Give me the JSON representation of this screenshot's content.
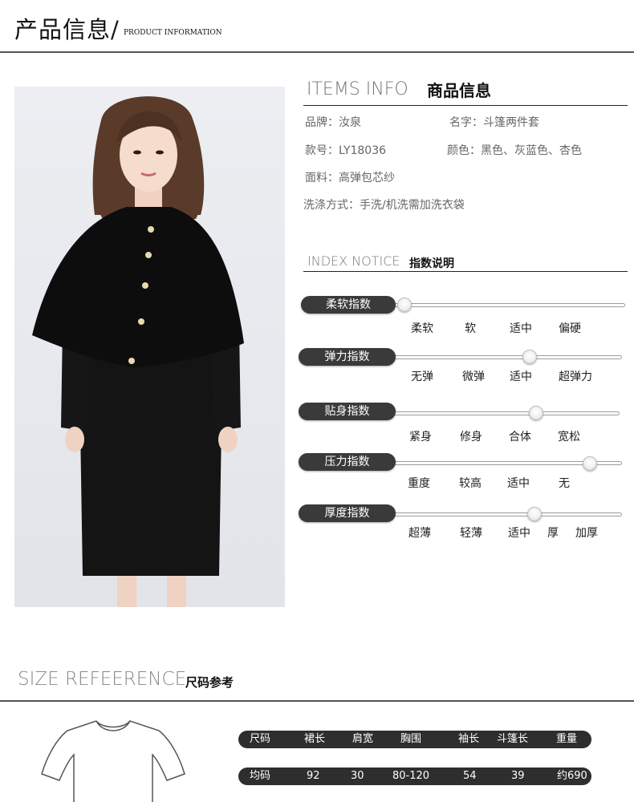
{
  "header": {
    "title_cn": "产品信息/",
    "title_en": "PRODUCT INFORMATION"
  },
  "items_info": {
    "title_en": "ITEMS INFO",
    "title_cn": "商品信息",
    "brand": "品牌：汝泉",
    "name": "名字：斗篷两件套",
    "model": "款号：LY18036",
    "colors": "颜色：黑色、灰蓝色、杏色",
    "fabric": "面料：高弹包芯纱",
    "washing": "洗涤方式：手洗/机洗需加洗衣袋"
  },
  "index_notice": {
    "title_en": "INDEX NOTICE",
    "title_cn": "指数说明",
    "rows": [
      {
        "label": "柔软指数",
        "options": [
          "柔软",
          "软",
          "适中",
          "偏硬"
        ],
        "level": 0.03
      },
      {
        "label": "弹力指数",
        "options": [
          "无弹",
          "微弹",
          "适中",
          "超弹力"
        ],
        "level": 0.57
      },
      {
        "label": "贴身指数",
        "options": [
          "紧身",
          "修身",
          "合体",
          "宽松"
        ],
        "level": 0.6
      },
      {
        "label": "压力指数",
        "options": [
          "重度",
          "较高",
          "适中",
          "无"
        ],
        "level": 0.83
      },
      {
        "label": "厚度指数",
        "options": [
          "超薄",
          "轻薄",
          "适中",
          "厚",
          "加厚"
        ],
        "level": 0.59
      }
    ]
  },
  "size_reference": {
    "title_en": "SIZE REFEERENCE",
    "title_cn": "尺码参考",
    "headers": [
      "尺码",
      "裙长",
      "肩宽",
      "胸围",
      "袖长",
      "斗篷长",
      "重量"
    ],
    "rows": [
      [
        "均码",
        "92",
        "30",
        "80-120",
        "54",
        "39",
        "约690"
      ]
    ]
  },
  "colors": {
    "pill": "#3a3a3a",
    "rule": "#555555"
  }
}
